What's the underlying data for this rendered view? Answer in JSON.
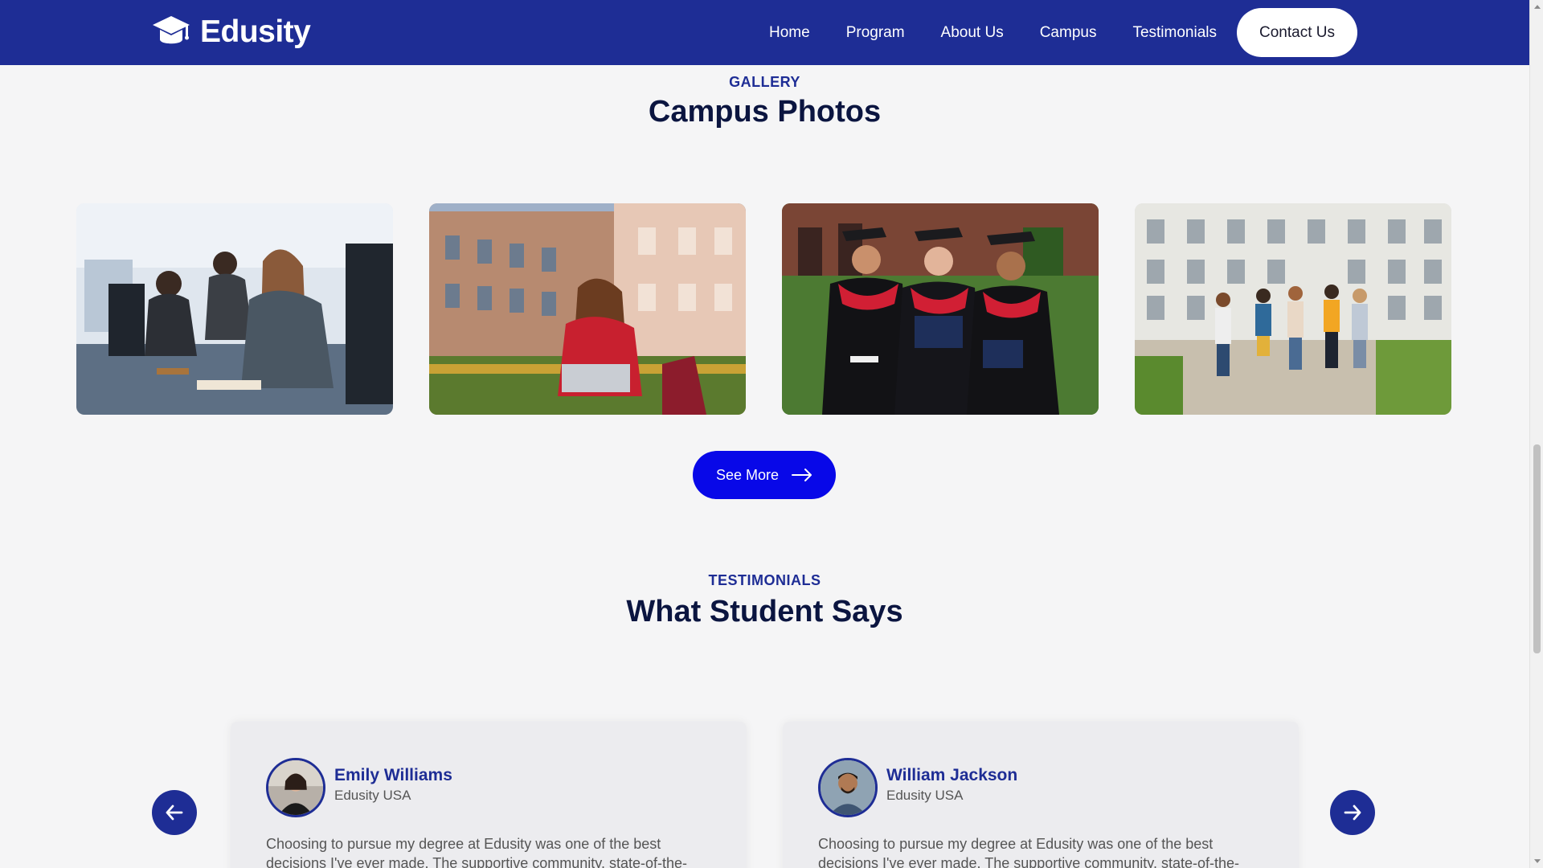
{
  "brand": {
    "name": "Edusity",
    "primary_color": "#1e2d95",
    "button_color": "#0808e8"
  },
  "nav": {
    "items": [
      {
        "label": "Home"
      },
      {
        "label": "Program"
      },
      {
        "label": "About Us"
      },
      {
        "label": "Campus"
      },
      {
        "label": "Testimonials"
      }
    ],
    "contact_label": "Contact Us"
  },
  "gallery": {
    "subtitle": "GALLERY",
    "title": "Campus Photos",
    "photos": [
      "students-in-computer-lab",
      "student-with-laptop-on-campus-lawn",
      "graduates-in-caps-and-gowns",
      "students-walking-on-campus"
    ],
    "see_more_label": "See More"
  },
  "testimonials": {
    "subtitle": "TESTIMONIALS",
    "title": "What Student Says",
    "cards": [
      {
        "name": "Emily Williams",
        "org": "Edusity USA",
        "quote": "Choosing to pursue my degree at Edusity was one of the best decisions I've ever made. The supportive community, state-of-the-art facilities, and commitment to academic excellence have truly exceeded my expectations."
      },
      {
        "name": "William Jackson",
        "org": "Edusity USA",
        "quote": "Choosing to pursue my degree at Edusity was one of the best decisions I've ever made. The supportive community, state-of-the-art facilities, and commitment to academic excellence have truly exceeded my expectations."
      }
    ]
  }
}
